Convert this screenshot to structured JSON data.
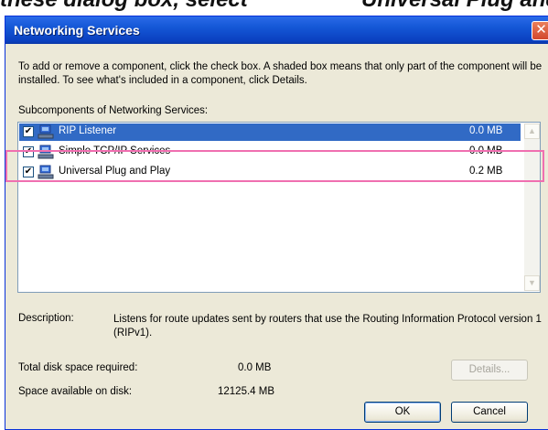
{
  "caption": {
    "left": "these dialog box, select",
    "right": "Universal Plug and Pla"
  },
  "window": {
    "title": "Networking Services",
    "close_glyph": "✕"
  },
  "intro_text": "To add or remove a component, click the check box. A shaded box means that only part of the component will be installed. To see what's included in a component, click Details.",
  "subcomponents_label": "Subcomponents of Networking Services:",
  "components": [
    {
      "name": "RIP Listener",
      "size": "0.0 MB",
      "checked": true,
      "selected": true,
      "icon": "network-service-icon"
    },
    {
      "name": "Simple TCP/IP Services",
      "size": "0.0 MB",
      "checked": true,
      "selected": false,
      "icon": "network-service-icon"
    },
    {
      "name": "Universal Plug and Play",
      "size": "0.2 MB",
      "checked": true,
      "selected": false,
      "icon": "network-service-icon"
    }
  ],
  "description": {
    "label": "Description:",
    "text": "Listens for route updates sent by routers that use the Routing Information Protocol version 1 (RIPv1)."
  },
  "disk": {
    "required_label": "Total disk space required:",
    "required_value": "0.0 MB",
    "available_label": "Space available on disk:",
    "available_value": "12125.4 MB"
  },
  "buttons": {
    "details": "Details...",
    "ok": "OK",
    "cancel": "Cancel"
  },
  "colors": {
    "highlight": "#f06fb0",
    "selection": "#316ac5",
    "titlebar": "#0a3fbf"
  }
}
